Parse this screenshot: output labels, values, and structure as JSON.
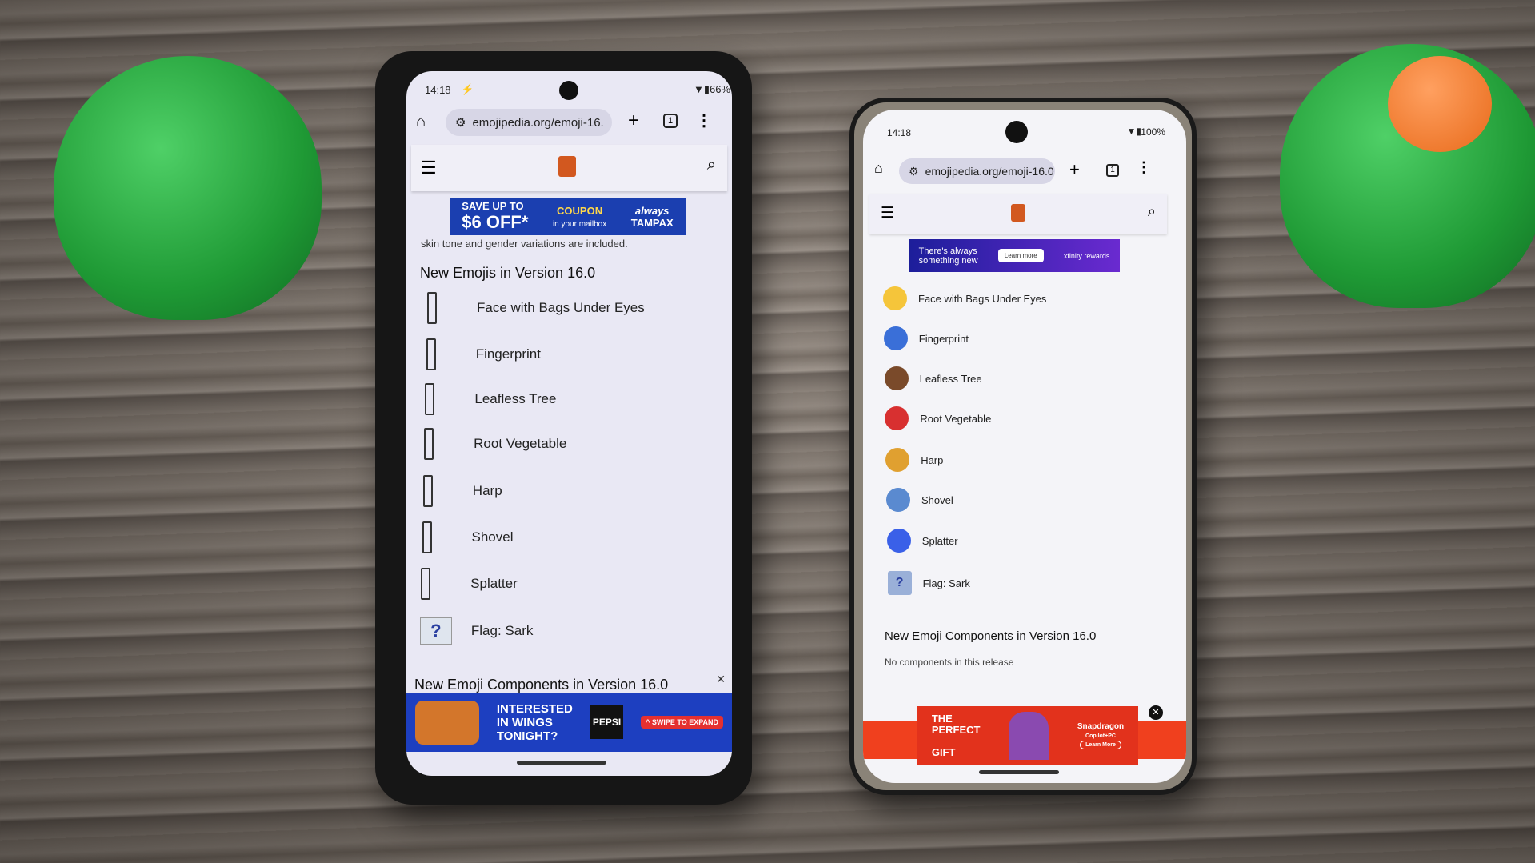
{
  "left_phone": {
    "status": {
      "time": "14:18",
      "charging_icon": "bolt-icon",
      "battery": "66%"
    },
    "browser": {
      "url": "emojipedia.org/emoji-16.",
      "tab_count": "1"
    },
    "top_ad": {
      "line1": "SAVE UP TO",
      "line2": "$6 OFF*",
      "coupon": "COUPON",
      "coupon_sub": "in your mailbox",
      "brand1": "always",
      "brand2": "TAMPAX"
    },
    "intro_text": "skin tone and gender variations are included.",
    "heading": "New Emojis in Version 16.0",
    "items": [
      "Face with Bags Under Eyes",
      "Fingerprint",
      "Leafless Tree",
      "Root Vegetable",
      "Harp",
      "Shovel",
      "Splatter",
      "Flag: Sark"
    ],
    "components_heading": "New Emoji Components in Version 16.0",
    "bottom_ad": {
      "text1": "INTERESTED",
      "text2": "IN WINGS",
      "text3": "TONIGHT?",
      "brand": "PEPSI",
      "cta": "^ SWIPE TO EXPAND"
    }
  },
  "right_phone": {
    "status": {
      "time": "14:18",
      "battery": "100%"
    },
    "browser": {
      "url": "emojipedia.org/emoji-16.0",
      "tab_count": "1"
    },
    "top_ad": {
      "text1": "There's always",
      "text2": "something new",
      "cta": "Learn more",
      "brand": "xfinity rewards"
    },
    "items": [
      "Face with Bags Under Eyes",
      "Fingerprint",
      "Leafless Tree",
      "Root Vegetable",
      "Harp",
      "Shovel",
      "Splatter",
      "Flag: Sark"
    ],
    "item_colors": [
      "#f5c53a",
      "#3a6fd8",
      "#7a4a2a",
      "#d83030",
      "#e0a030",
      "#5a8ad0",
      "#3a60e8",
      "#9ab0d8"
    ],
    "components_heading": "New Emoji Components in Version 16.0",
    "components_text": "No components in this release",
    "bottom_ad": {
      "text1": "THE",
      "text2": "PERFECT",
      "text3": "GIFT",
      "brand": "Snapdragon",
      "sub": "Copilot+PC",
      "cta": "Learn More"
    }
  }
}
